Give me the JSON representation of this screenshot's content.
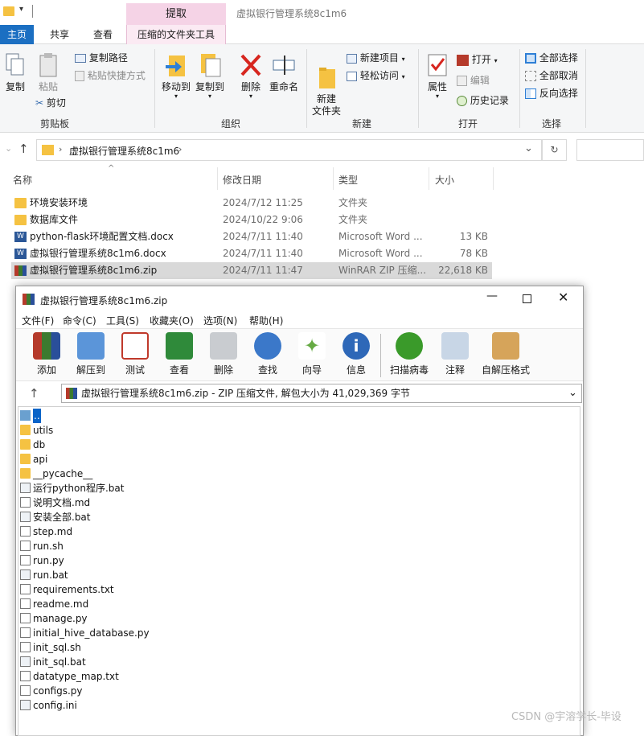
{
  "explorer": {
    "context_tab_group": "提取",
    "window_title": "虚拟银行管理系统8c1m6",
    "tabs": {
      "home": "主页",
      "share": "共享",
      "view": "查看",
      "compressed_tools": "压缩的文件夹工具"
    },
    "ribbon": {
      "clipboard": {
        "copy": "复制",
        "paste": "粘贴",
        "copy_path": "复制路径",
        "paste_shortcut": "粘贴快捷方式",
        "cut": "剪切",
        "group": "剪贴板"
      },
      "organize": {
        "move_to": "移动到",
        "copy_to": "复制到",
        "delete": "删除",
        "rename": "重命名",
        "group": "组织"
      },
      "new": {
        "new_folder": "新建\n文件夹",
        "new_item": "新建项目",
        "easy_access": "轻松访问",
        "group": "新建"
      },
      "open": {
        "properties": "属性",
        "open": "打开",
        "edit": "编辑",
        "history": "历史记录",
        "group": "打开"
      },
      "select": {
        "select_all": "全部选择",
        "select_none": "全部取消",
        "invert": "反向选择",
        "group": "选择"
      }
    },
    "address": {
      "path": "虚拟银行管理系统8c1m6"
    },
    "columns": {
      "name": "名称",
      "date": "修改日期",
      "type": "类型",
      "size": "大小"
    },
    "files": [
      {
        "name": "环境安装环境",
        "date": "2024/7/12 11:25",
        "type": "文件夹",
        "size": ""
      },
      {
        "name": "数据库文件",
        "date": "2024/10/22 9:06",
        "type": "文件夹",
        "size": ""
      },
      {
        "name": "python-flask环境配置文档.docx",
        "date": "2024/7/11 11:40",
        "type": "Microsoft Word ...",
        "size": "13 KB"
      },
      {
        "name": "虚拟银行管理系统8c1m6.docx",
        "date": "2024/7/11 11:40",
        "type": "Microsoft Word ...",
        "size": "78 KB"
      },
      {
        "name": "虚拟银行管理系统8c1m6.zip",
        "date": "2024/7/11 11:47",
        "type": "WinRAR ZIP 压缩...",
        "size": "22,618 KB"
      }
    ]
  },
  "winrar": {
    "title": "虚拟银行管理系统8c1m6.zip",
    "menu": [
      "文件(F)",
      "命令(C)",
      "工具(S)",
      "收藏夹(O)",
      "选项(N)",
      "帮助(H)"
    ],
    "toolbar": [
      "添加",
      "解压到",
      "测试",
      "查看",
      "删除",
      "查找",
      "向导",
      "信息",
      "扫描病毒",
      "注释",
      "自解压格式"
    ],
    "path": "虚拟银行管理系统8c1m6.zip - ZIP 压缩文件, 解包大小为 41,029,369 字节",
    "items": [
      {
        "name": "..",
        "kind": "up"
      },
      {
        "name": "utils",
        "kind": "folder"
      },
      {
        "name": "db",
        "kind": "folder"
      },
      {
        "name": "api",
        "kind": "folder"
      },
      {
        "name": "__pycache__",
        "kind": "folder"
      },
      {
        "name": "运行python程序.bat",
        "kind": "bat"
      },
      {
        "name": "说明文档.md",
        "kind": "file"
      },
      {
        "name": "安装全部.bat",
        "kind": "bat"
      },
      {
        "name": "step.md",
        "kind": "file"
      },
      {
        "name": "run.sh",
        "kind": "file"
      },
      {
        "name": "run.py",
        "kind": "file"
      },
      {
        "name": "run.bat",
        "kind": "bat"
      },
      {
        "name": "requirements.txt",
        "kind": "file"
      },
      {
        "name": "readme.md",
        "kind": "file"
      },
      {
        "name": "manage.py",
        "kind": "file"
      },
      {
        "name": "initial_hive_database.py",
        "kind": "file"
      },
      {
        "name": "init_sql.sh",
        "kind": "file"
      },
      {
        "name": "init_sql.bat",
        "kind": "bat"
      },
      {
        "name": "datatype_map.txt",
        "kind": "file"
      },
      {
        "name": "configs.py",
        "kind": "file"
      },
      {
        "name": "config.ini",
        "kind": "bat"
      }
    ]
  },
  "watermark": "CSDN @宇溶学长-毕设"
}
